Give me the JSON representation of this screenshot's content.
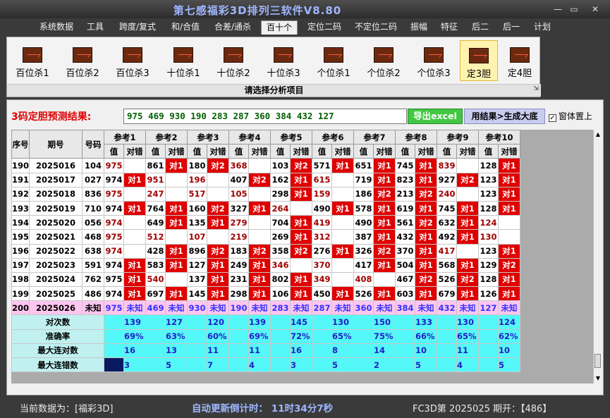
{
  "app": {
    "title": "第七感福彩3D排列三软件V8.80"
  },
  "window_controls": {
    "minimize": "—",
    "maximize": "▭",
    "close": "✕"
  },
  "menu": [
    {
      "label": "系统数据"
    },
    {
      "label": "工具"
    },
    {
      "label": "跨度/复式"
    },
    {
      "label": "和/合值"
    },
    {
      "label": "合差/通杀"
    },
    {
      "label": "百十个",
      "active": true
    },
    {
      "label": "定位二码"
    },
    {
      "label": "不定位二码"
    },
    {
      "label": "振幅"
    },
    {
      "label": "特征"
    },
    {
      "label": "后二"
    },
    {
      "label": "后一"
    },
    {
      "label": "计划"
    }
  ],
  "ribbon": {
    "buttons": [
      {
        "label": "百位杀1"
      },
      {
        "label": "百位杀2"
      },
      {
        "label": "百位杀3"
      },
      {
        "label": "十位杀1"
      },
      {
        "label": "十位杀2"
      },
      {
        "label": "十位杀3"
      },
      {
        "label": "个位杀1"
      },
      {
        "label": "个位杀2"
      },
      {
        "label": "个位杀3"
      },
      {
        "label": "定3胆",
        "active": true
      },
      {
        "label": "定4胆"
      }
    ],
    "caption": "请选择分析项目",
    "corner": "⇲"
  },
  "result": {
    "label": "3码定胆预测结果:",
    "value": "975 469 930 190 283 287 360 384 432 127",
    "export_button": "导出excel",
    "generate_button": "用结果>生成大底",
    "ontop_label": "窗体置上",
    "ontop_checked": "✓"
  },
  "table": {
    "col_seq": "序号",
    "col_period": "期号",
    "col_number": "号码",
    "ref_headers": [
      "参考1",
      "参考2",
      "参考3",
      "参考4",
      "参考5",
      "参考6",
      "参考7",
      "参考8",
      "参考9",
      "参考10"
    ],
    "sub_value": "值",
    "sub_result": "对错",
    "rows": [
      {
        "seq": "190",
        "period": "2025016",
        "number": "104",
        "cells": [
          [
            "975",
            "r",
            ""
          ],
          [
            "861",
            "k",
            "对1"
          ],
          [
            "180",
            "k",
            "对2"
          ],
          [
            "368",
            "r",
            ""
          ],
          [
            "103",
            "k",
            "对2"
          ],
          [
            "571",
            "k",
            "对1"
          ],
          [
            "651",
            "k",
            "对1"
          ],
          [
            "745",
            "k",
            "对1"
          ],
          [
            "839",
            "r",
            ""
          ],
          [
            "128",
            "k",
            "对1"
          ]
        ]
      },
      {
        "seq": "191",
        "period": "2025017",
        "number": "027",
        "cells": [
          [
            "974",
            "k",
            "对1"
          ],
          [
            "951",
            "r",
            ""
          ],
          [
            "196",
            "r",
            ""
          ],
          [
            "407",
            "k",
            "对2"
          ],
          [
            "162",
            "k",
            "对1"
          ],
          [
            "615",
            "r",
            ""
          ],
          [
            "719",
            "k",
            "对1"
          ],
          [
            "823",
            "k",
            "对1"
          ],
          [
            "927",
            "k",
            "对2"
          ],
          [
            "123",
            "k",
            "对1"
          ]
        ]
      },
      {
        "seq": "192",
        "period": "2025018",
        "number": "836",
        "cells": [
          [
            "975",
            "r",
            ""
          ],
          [
            "247",
            "r",
            ""
          ],
          [
            "517",
            "r",
            ""
          ],
          [
            "105",
            "r",
            ""
          ],
          [
            "298",
            "k",
            "对1"
          ],
          [
            "159",
            "r",
            ""
          ],
          [
            "186",
            "k",
            "对2"
          ],
          [
            "213",
            "k",
            "对2"
          ],
          [
            "240",
            "r",
            ""
          ],
          [
            "123",
            "k",
            "对1"
          ]
        ]
      },
      {
        "seq": "193",
        "period": "2025019",
        "number": "710",
        "cells": [
          [
            "974",
            "k",
            "对1"
          ],
          [
            "764",
            "k",
            "对1"
          ],
          [
            "160",
            "k",
            "对2"
          ],
          [
            "327",
            "k",
            "对1"
          ],
          [
            "264",
            "r",
            ""
          ],
          [
            "490",
            "k",
            "对1"
          ],
          [
            "578",
            "k",
            "对1"
          ],
          [
            "619",
            "k",
            "对1"
          ],
          [
            "745",
            "k",
            "对1"
          ],
          [
            "128",
            "k",
            "对1"
          ]
        ]
      },
      {
        "seq": "194",
        "period": "2025020",
        "number": "056",
        "cells": [
          [
            "974",
            "r",
            ""
          ],
          [
            "649",
            "k",
            "对1"
          ],
          [
            "135",
            "k",
            "对1"
          ],
          [
            "279",
            "r",
            ""
          ],
          [
            "704",
            "k",
            "对1"
          ],
          [
            "419",
            "r",
            ""
          ],
          [
            "490",
            "k",
            "对1"
          ],
          [
            "561",
            "k",
            "对2"
          ],
          [
            "632",
            "k",
            "对1"
          ],
          [
            "124",
            "r",
            ""
          ]
        ]
      },
      {
        "seq": "195",
        "period": "2025021",
        "number": "468",
        "cells": [
          [
            "975",
            "r",
            ""
          ],
          [
            "512",
            "r",
            ""
          ],
          [
            "107",
            "r",
            ""
          ],
          [
            "219",
            "r",
            ""
          ],
          [
            "269",
            "k",
            "对1"
          ],
          [
            "312",
            "r",
            ""
          ],
          [
            "387",
            "k",
            "对1"
          ],
          [
            "432",
            "k",
            "对1"
          ],
          [
            "492",
            "k",
            "对1"
          ],
          [
            "130",
            "r",
            ""
          ]
        ]
      },
      {
        "seq": "196",
        "period": "2025022",
        "number": "638",
        "cells": [
          [
            "974",
            "r",
            ""
          ],
          [
            "428",
            "k",
            "对1"
          ],
          [
            "896",
            "k",
            "对2"
          ],
          [
            "183",
            "k",
            "对2"
          ],
          [
            "358",
            "k",
            "对2"
          ],
          [
            "276",
            "k",
            "对1"
          ],
          [
            "326",
            "k",
            "对2"
          ],
          [
            "370",
            "k",
            "对1"
          ],
          [
            "417",
            "r",
            ""
          ],
          [
            "123",
            "k",
            "对1"
          ]
        ]
      },
      {
        "seq": "197",
        "period": "2025023",
        "number": "591",
        "cells": [
          [
            "974",
            "k",
            "对1"
          ],
          [
            "583",
            "k",
            "对1"
          ],
          [
            "127",
            "k",
            "对1"
          ],
          [
            "249",
            "k",
            "对1"
          ],
          [
            "346",
            "r",
            ""
          ],
          [
            "370",
            "r",
            ""
          ],
          [
            "417",
            "k",
            "对1"
          ],
          [
            "504",
            "k",
            "对1"
          ],
          [
            "568",
            "k",
            "对1"
          ],
          [
            "129",
            "k",
            "对2"
          ]
        ]
      },
      {
        "seq": "198",
        "period": "2025024",
        "number": "762",
        "cells": [
          [
            "975",
            "k",
            "对1"
          ],
          [
            "540",
            "r",
            ""
          ],
          [
            "137",
            "k",
            "对1"
          ],
          [
            "231",
            "k",
            "对1"
          ],
          [
            "802",
            "k",
            "对1"
          ],
          [
            "349",
            "r",
            ""
          ],
          [
            "408",
            "r",
            ""
          ],
          [
            "467",
            "k",
            "对2"
          ],
          [
            "526",
            "k",
            "对2"
          ],
          [
            "128",
            "k",
            "对1"
          ]
        ]
      },
      {
        "seq": "199",
        "period": "2025025",
        "number": "486",
        "cells": [
          [
            "974",
            "k",
            "对1"
          ],
          [
            "697",
            "k",
            "对1"
          ],
          [
            "145",
            "k",
            "对1"
          ],
          [
            "298",
            "k",
            "对1"
          ],
          [
            "106",
            "k",
            "对1"
          ],
          [
            "450",
            "k",
            "对1"
          ],
          [
            "526",
            "k",
            "对1"
          ],
          [
            "603",
            "k",
            "对1"
          ],
          [
            "679",
            "k",
            "对1"
          ],
          [
            "126",
            "k",
            "对1"
          ]
        ]
      }
    ],
    "forecast": {
      "seq": "200",
      "period": "2025026",
      "number": "未知",
      "values": [
        "975",
        "469",
        "930",
        "190",
        "283",
        "287",
        "360",
        "384",
        "432",
        "127"
      ],
      "result": "未知"
    },
    "stats": [
      {
        "label": "对次数",
        "values": [
          "139",
          "127",
          "120",
          "139",
          "145",
          "130",
          "150",
          "133",
          "130",
          "124"
        ]
      },
      {
        "label": "准确率",
        "values": [
          "69%",
          "63%",
          "60%",
          "69%",
          "72%",
          "65%",
          "75%",
          "66%",
          "65%",
          "62%"
        ]
      },
      {
        "label": "最大连对数",
        "values": [
          "16",
          "13",
          "11",
          "11",
          "16",
          "8",
          "14",
          "10",
          "11",
          "10"
        ]
      },
      {
        "label": "最大连错数",
        "values": [
          "3",
          "5",
          "7",
          "4",
          "3",
          "5",
          "2",
          "5",
          "4",
          "5"
        ]
      }
    ]
  },
  "status": {
    "current_data": "当前数据为：[福彩3D]",
    "countdown": "自动更新倒计时： 11时34分7秒",
    "period_info": "FC3D第 2025025 期开：【486】"
  },
  "colors": {
    "hit": "#e00000",
    "miss_value": "#a00000",
    "forecast_row": "#ffc6f0",
    "stats_row": "#55f8f8",
    "result_text": "#006000"
  }
}
